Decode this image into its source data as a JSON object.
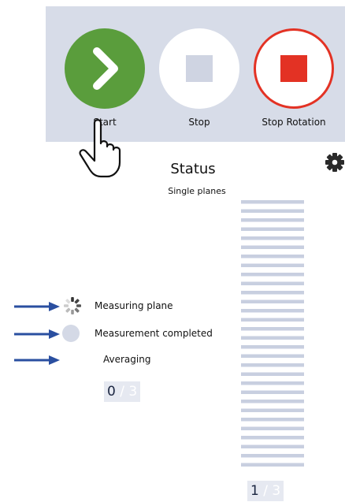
{
  "toolbar": {
    "start_label": "Start",
    "stop_label": "Stop",
    "stop_rotation_label": "Stop Rotation"
  },
  "status": {
    "title": "Status",
    "subtitle": "Single planes"
  },
  "legend": {
    "measuring_label": "Measuring plane",
    "completed_label": "Measurement completed",
    "averaging_label": "Averaging"
  },
  "averaging_counter": {
    "current": "0",
    "separator": "/",
    "total": "3"
  },
  "planes_counter": {
    "current": "1",
    "separator": "/",
    "total": "3"
  },
  "colors": {
    "start_green": "#5a9d3c",
    "stop_red": "#e33224",
    "toolbar_bg": "#d7dce8",
    "plane_bar": "#c8cfe0",
    "arrow_blue": "#2a4fa0"
  }
}
